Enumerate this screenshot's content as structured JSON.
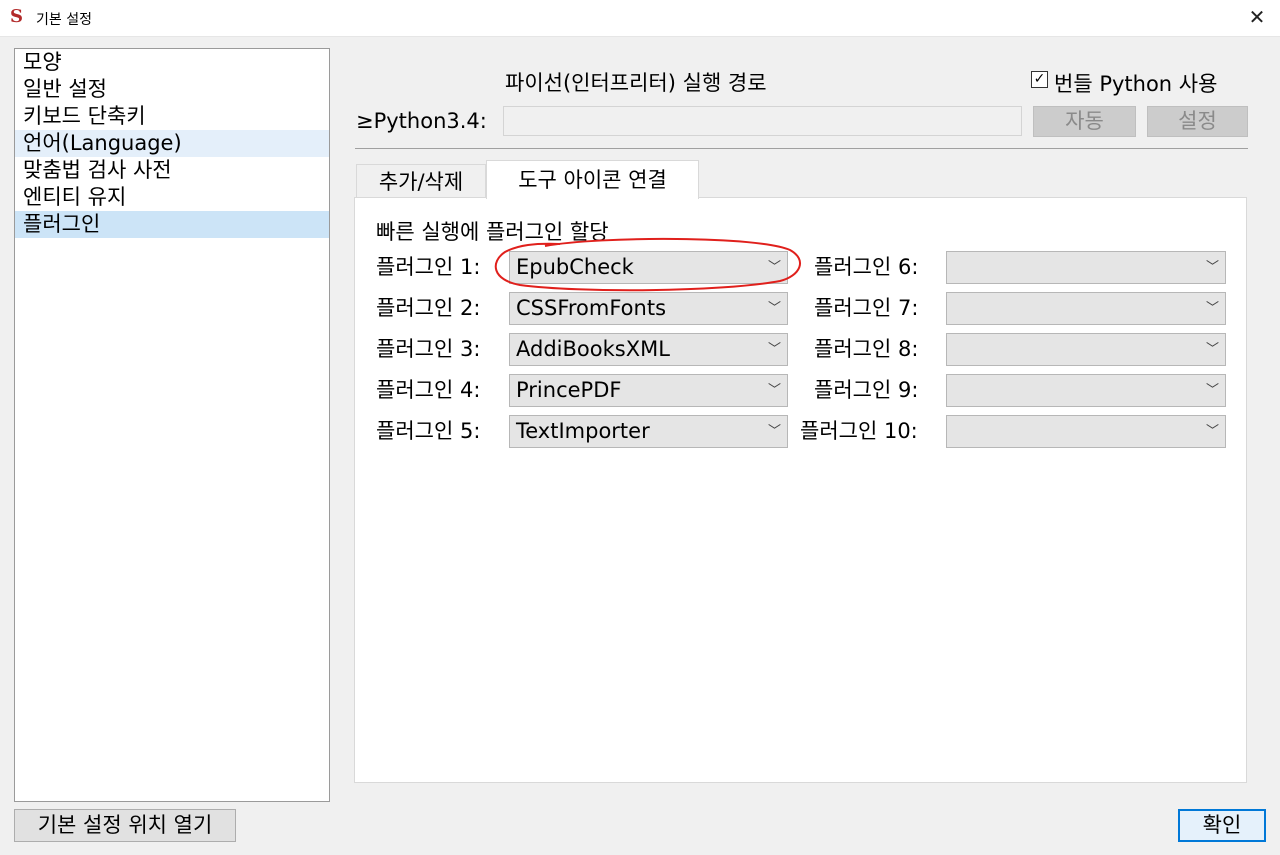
{
  "window": {
    "title": "기본 설정",
    "app_icon": "S",
    "close": "✕"
  },
  "sidebar": {
    "items": [
      {
        "label": "모양",
        "state": "normal"
      },
      {
        "label": "일반 설정",
        "state": "normal"
      },
      {
        "label": "키보드 단축키",
        "state": "normal"
      },
      {
        "label": "언어(Language)",
        "state": "hover"
      },
      {
        "label": "맞춤법 검사 사전",
        "state": "normal"
      },
      {
        "label": "엔티티 유지",
        "state": "normal"
      },
      {
        "label": "플러그인",
        "state": "selected"
      }
    ]
  },
  "python": {
    "heading": "파이선(인터프리터) 실행 경로",
    "bundled_label": "번들 Python 사용",
    "bundled_checked": true,
    "version_label": "≥Python3.4:",
    "path_value": "",
    "auto_button": "자동",
    "set_button": "설정"
  },
  "tabs": [
    {
      "label": "추가/삭제",
      "active": false
    },
    {
      "label": "도구 아이콘 연결",
      "active": true
    }
  ],
  "quicklaunch": {
    "heading": "빠른 실행에 플러그인 할당",
    "left": [
      {
        "label": "플러그인 1:",
        "value": "EpubCheck",
        "annotated": true
      },
      {
        "label": "플러그인 2:",
        "value": "CSSFromFonts"
      },
      {
        "label": "플러그인 3:",
        "value": "AddiBooksXML"
      },
      {
        "label": "플러그인 4:",
        "value": "PrincePDF"
      },
      {
        "label": "플러그인 5:",
        "value": "TextImporter"
      }
    ],
    "right": [
      {
        "label": "플러그인 6:",
        "value": ""
      },
      {
        "label": "플러그인 7:",
        "value": ""
      },
      {
        "label": "플러그인 8:",
        "value": ""
      },
      {
        "label": "플러그인 9:",
        "value": ""
      },
      {
        "label": "플러그인 10:",
        "value": ""
      }
    ]
  },
  "footer": {
    "open_location_button": "기본 설정 위치 열기",
    "ok_button": "확인"
  },
  "colors": {
    "accent": "#0078d7",
    "selected": "#cce4f7",
    "hover": "#e4effa",
    "annotation": "#e0201c"
  }
}
